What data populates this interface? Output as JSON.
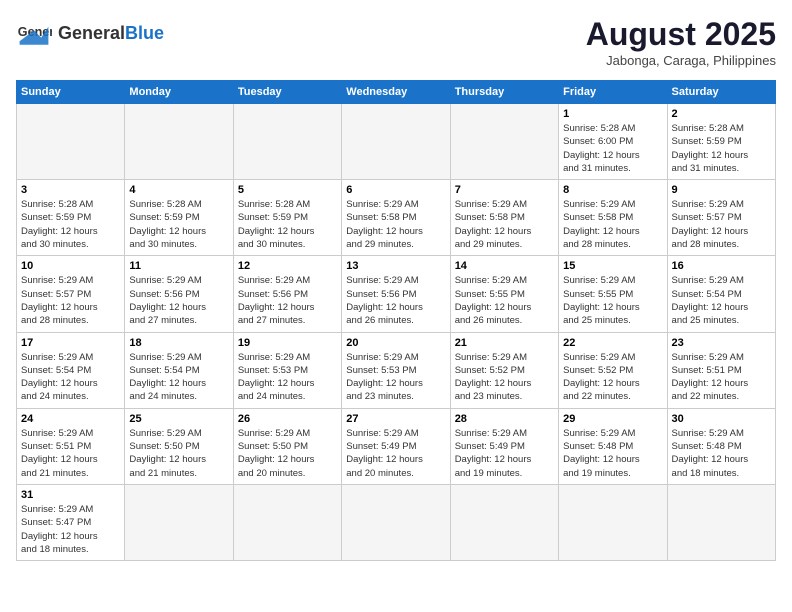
{
  "header": {
    "logo_general": "General",
    "logo_blue": "Blue",
    "month_title": "August 2025",
    "subtitle": "Jabonga, Caraga, Philippines"
  },
  "days_of_week": [
    "Sunday",
    "Monday",
    "Tuesday",
    "Wednesday",
    "Thursday",
    "Friday",
    "Saturday"
  ],
  "weeks": [
    [
      {
        "day": "",
        "info": ""
      },
      {
        "day": "",
        "info": ""
      },
      {
        "day": "",
        "info": ""
      },
      {
        "day": "",
        "info": ""
      },
      {
        "day": "",
        "info": ""
      },
      {
        "day": "1",
        "info": "Sunrise: 5:28 AM\nSunset: 6:00 PM\nDaylight: 12 hours\nand 31 minutes."
      },
      {
        "day": "2",
        "info": "Sunrise: 5:28 AM\nSunset: 5:59 PM\nDaylight: 12 hours\nand 31 minutes."
      }
    ],
    [
      {
        "day": "3",
        "info": "Sunrise: 5:28 AM\nSunset: 5:59 PM\nDaylight: 12 hours\nand 30 minutes."
      },
      {
        "day": "4",
        "info": "Sunrise: 5:28 AM\nSunset: 5:59 PM\nDaylight: 12 hours\nand 30 minutes."
      },
      {
        "day": "5",
        "info": "Sunrise: 5:28 AM\nSunset: 5:59 PM\nDaylight: 12 hours\nand 30 minutes."
      },
      {
        "day": "6",
        "info": "Sunrise: 5:29 AM\nSunset: 5:58 PM\nDaylight: 12 hours\nand 29 minutes."
      },
      {
        "day": "7",
        "info": "Sunrise: 5:29 AM\nSunset: 5:58 PM\nDaylight: 12 hours\nand 29 minutes."
      },
      {
        "day": "8",
        "info": "Sunrise: 5:29 AM\nSunset: 5:58 PM\nDaylight: 12 hours\nand 28 minutes."
      },
      {
        "day": "9",
        "info": "Sunrise: 5:29 AM\nSunset: 5:57 PM\nDaylight: 12 hours\nand 28 minutes."
      }
    ],
    [
      {
        "day": "10",
        "info": "Sunrise: 5:29 AM\nSunset: 5:57 PM\nDaylight: 12 hours\nand 28 minutes."
      },
      {
        "day": "11",
        "info": "Sunrise: 5:29 AM\nSunset: 5:56 PM\nDaylight: 12 hours\nand 27 minutes."
      },
      {
        "day": "12",
        "info": "Sunrise: 5:29 AM\nSunset: 5:56 PM\nDaylight: 12 hours\nand 27 minutes."
      },
      {
        "day": "13",
        "info": "Sunrise: 5:29 AM\nSunset: 5:56 PM\nDaylight: 12 hours\nand 26 minutes."
      },
      {
        "day": "14",
        "info": "Sunrise: 5:29 AM\nSunset: 5:55 PM\nDaylight: 12 hours\nand 26 minutes."
      },
      {
        "day": "15",
        "info": "Sunrise: 5:29 AM\nSunset: 5:55 PM\nDaylight: 12 hours\nand 25 minutes."
      },
      {
        "day": "16",
        "info": "Sunrise: 5:29 AM\nSunset: 5:54 PM\nDaylight: 12 hours\nand 25 minutes."
      }
    ],
    [
      {
        "day": "17",
        "info": "Sunrise: 5:29 AM\nSunset: 5:54 PM\nDaylight: 12 hours\nand 24 minutes."
      },
      {
        "day": "18",
        "info": "Sunrise: 5:29 AM\nSunset: 5:54 PM\nDaylight: 12 hours\nand 24 minutes."
      },
      {
        "day": "19",
        "info": "Sunrise: 5:29 AM\nSunset: 5:53 PM\nDaylight: 12 hours\nand 24 minutes."
      },
      {
        "day": "20",
        "info": "Sunrise: 5:29 AM\nSunset: 5:53 PM\nDaylight: 12 hours\nand 23 minutes."
      },
      {
        "day": "21",
        "info": "Sunrise: 5:29 AM\nSunset: 5:52 PM\nDaylight: 12 hours\nand 23 minutes."
      },
      {
        "day": "22",
        "info": "Sunrise: 5:29 AM\nSunset: 5:52 PM\nDaylight: 12 hours\nand 22 minutes."
      },
      {
        "day": "23",
        "info": "Sunrise: 5:29 AM\nSunset: 5:51 PM\nDaylight: 12 hours\nand 22 minutes."
      }
    ],
    [
      {
        "day": "24",
        "info": "Sunrise: 5:29 AM\nSunset: 5:51 PM\nDaylight: 12 hours\nand 21 minutes."
      },
      {
        "day": "25",
        "info": "Sunrise: 5:29 AM\nSunset: 5:50 PM\nDaylight: 12 hours\nand 21 minutes."
      },
      {
        "day": "26",
        "info": "Sunrise: 5:29 AM\nSunset: 5:50 PM\nDaylight: 12 hours\nand 20 minutes."
      },
      {
        "day": "27",
        "info": "Sunrise: 5:29 AM\nSunset: 5:49 PM\nDaylight: 12 hours\nand 20 minutes."
      },
      {
        "day": "28",
        "info": "Sunrise: 5:29 AM\nSunset: 5:49 PM\nDaylight: 12 hours\nand 19 minutes."
      },
      {
        "day": "29",
        "info": "Sunrise: 5:29 AM\nSunset: 5:48 PM\nDaylight: 12 hours\nand 19 minutes."
      },
      {
        "day": "30",
        "info": "Sunrise: 5:29 AM\nSunset: 5:48 PM\nDaylight: 12 hours\nand 18 minutes."
      }
    ],
    [
      {
        "day": "31",
        "info": "Sunrise: 5:29 AM\nSunset: 5:47 PM\nDaylight: 12 hours\nand 18 minutes."
      },
      {
        "day": "",
        "info": ""
      },
      {
        "day": "",
        "info": ""
      },
      {
        "day": "",
        "info": ""
      },
      {
        "day": "",
        "info": ""
      },
      {
        "day": "",
        "info": ""
      },
      {
        "day": "",
        "info": ""
      }
    ]
  ]
}
